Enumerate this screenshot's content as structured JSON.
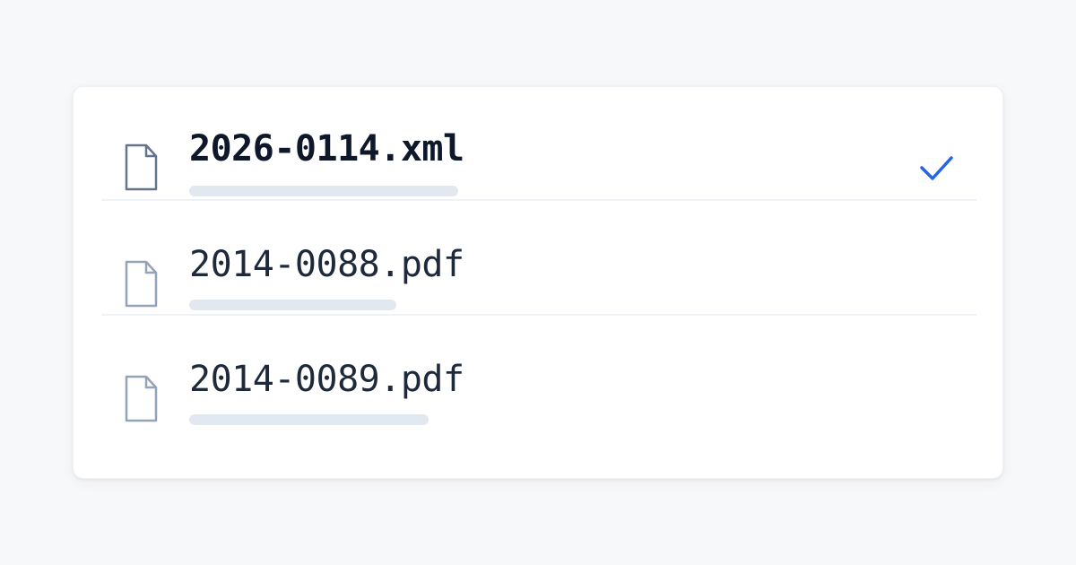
{
  "files": [
    {
      "name": "2026-0114.xml",
      "selected": true,
      "icon": "file-icon",
      "progress": 1.0
    },
    {
      "name": "2014-0088.pdf",
      "selected": false,
      "icon": "file-icon",
      "progress": 0.77
    },
    {
      "name": "2014-0089.pdf",
      "selected": false,
      "icon": "file-icon",
      "progress": 0.89
    }
  ],
  "colors": {
    "background": "#f7f8fa",
    "card": "#ffffff",
    "accent": "#2563eb",
    "selected_text": "#0f172a",
    "text": "#1e293b",
    "icon_selected": "#64748b",
    "icon": "#94a3b8",
    "bar": "#e2e8f0",
    "divider": "#eef1f5"
  },
  "selected_indicator": "check-icon"
}
